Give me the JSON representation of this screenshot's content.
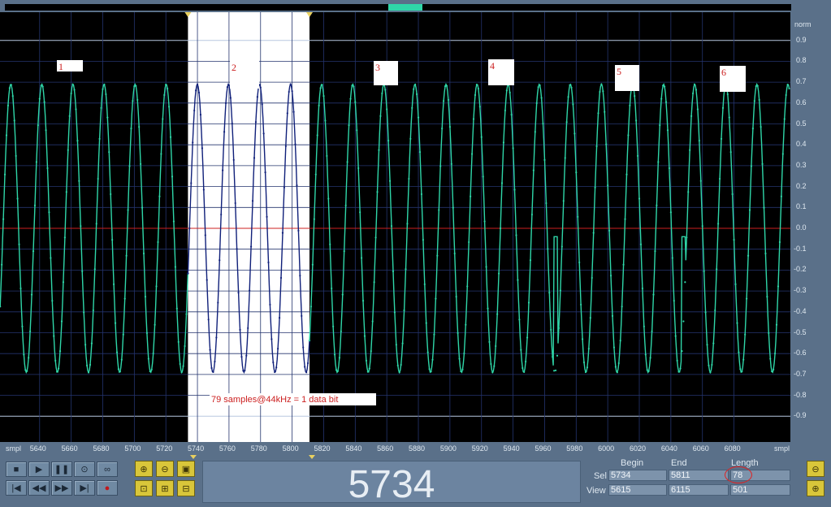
{
  "window": {
    "title": ""
  },
  "ruler": {
    "unit_left": "smpl",
    "unit_right": "smpl",
    "yunit": "norm"
  },
  "yticks": [
    "0.9",
    "0.8",
    "0.7",
    "0.6",
    "0.5",
    "0.4",
    "0.3",
    "0.2",
    "0.1",
    "0.0",
    "-0.1",
    "-0.2",
    "-0.3",
    "-0.4",
    "-0.5",
    "-0.6",
    "-0.7",
    "-0.8",
    "-0.9"
  ],
  "xticks": [
    "5640",
    "5660",
    "5680",
    "5700",
    "5720",
    "5740",
    "5760",
    "5780",
    "5800",
    "5820",
    "5840",
    "5860",
    "5880",
    "5900",
    "5920",
    "5940",
    "5960",
    "5980",
    "6000",
    "6020",
    "6040",
    "6060",
    "6080"
  ],
  "annotations": {
    "labels": [
      "1",
      "2",
      "3",
      "4",
      "5",
      "6"
    ],
    "note": "79 samples@44kHz = 1 data bit"
  },
  "selection": {
    "begin": 5734,
    "end": 5811
  },
  "view": {
    "begin": 5615,
    "end": 6115
  },
  "colors": {
    "wave": "#2fd6a8",
    "selected_wave": "#10207a",
    "zero_line": "#cc2020",
    "background": "#000000",
    "selection_bg": "#ffffff",
    "marker": "#e8d060"
  },
  "transport": {
    "buttons": [
      "stop-icon",
      "play-icon",
      "pause-icon",
      "play-selection-icon",
      "loop-icon",
      "skip-start-icon",
      "rewind-icon",
      "fast-forward-icon",
      "skip-end-icon",
      "record-icon"
    ]
  },
  "zoom": {
    "buttons": [
      "zoom-in-icon",
      "zoom-out-icon",
      "zoom-fit-icon",
      "zoom-selection-icon",
      "zoom-full-icon",
      "zoom-reset-icon"
    ]
  },
  "counter": {
    "value": "5734"
  },
  "info": {
    "headers": {
      "begin": "Begin",
      "end": "End",
      "length": "Length"
    },
    "sel": {
      "label": "Sel",
      "begin": "5734",
      "end": "5811",
      "length": "78"
    },
    "view": {
      "label": "View",
      "begin": "5615",
      "end": "6115",
      "length": "501"
    }
  },
  "chart_data": {
    "type": "line",
    "title": "",
    "xlabel": "smpl",
    "ylabel": "norm",
    "xlim": [
      5615,
      6115
    ],
    "ylim": [
      -1,
      1
    ],
    "grid": true,
    "series": [
      {
        "values_note": "",
        "amplitude": 0.69,
        "samples_per_cycle": 19.7
      }
    ]
  }
}
